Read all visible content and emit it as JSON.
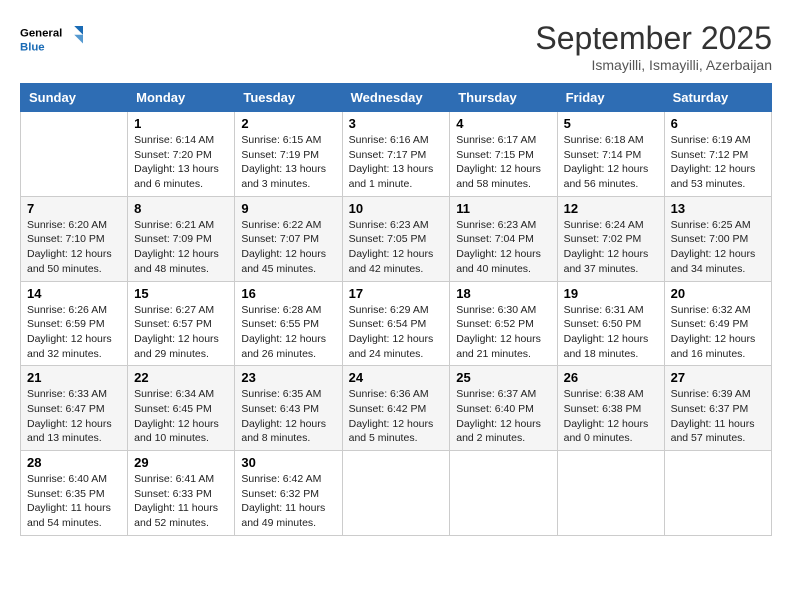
{
  "header": {
    "logo_line1": "General",
    "logo_line2": "Blue",
    "month": "September 2025",
    "location": "Ismayilli, Ismayilli, Azerbaijan"
  },
  "days_of_week": [
    "Sunday",
    "Monday",
    "Tuesday",
    "Wednesday",
    "Thursday",
    "Friday",
    "Saturday"
  ],
  "weeks": [
    [
      {
        "day": "",
        "info": ""
      },
      {
        "day": "1",
        "info": "Sunrise: 6:14 AM\nSunset: 7:20 PM\nDaylight: 13 hours\nand 6 minutes."
      },
      {
        "day": "2",
        "info": "Sunrise: 6:15 AM\nSunset: 7:19 PM\nDaylight: 13 hours\nand 3 minutes."
      },
      {
        "day": "3",
        "info": "Sunrise: 6:16 AM\nSunset: 7:17 PM\nDaylight: 13 hours\nand 1 minute."
      },
      {
        "day": "4",
        "info": "Sunrise: 6:17 AM\nSunset: 7:15 PM\nDaylight: 12 hours\nand 58 minutes."
      },
      {
        "day": "5",
        "info": "Sunrise: 6:18 AM\nSunset: 7:14 PM\nDaylight: 12 hours\nand 56 minutes."
      },
      {
        "day": "6",
        "info": "Sunrise: 6:19 AM\nSunset: 7:12 PM\nDaylight: 12 hours\nand 53 minutes."
      }
    ],
    [
      {
        "day": "7",
        "info": "Sunrise: 6:20 AM\nSunset: 7:10 PM\nDaylight: 12 hours\nand 50 minutes."
      },
      {
        "day": "8",
        "info": "Sunrise: 6:21 AM\nSunset: 7:09 PM\nDaylight: 12 hours\nand 48 minutes."
      },
      {
        "day": "9",
        "info": "Sunrise: 6:22 AM\nSunset: 7:07 PM\nDaylight: 12 hours\nand 45 minutes."
      },
      {
        "day": "10",
        "info": "Sunrise: 6:23 AM\nSunset: 7:05 PM\nDaylight: 12 hours\nand 42 minutes."
      },
      {
        "day": "11",
        "info": "Sunrise: 6:23 AM\nSunset: 7:04 PM\nDaylight: 12 hours\nand 40 minutes."
      },
      {
        "day": "12",
        "info": "Sunrise: 6:24 AM\nSunset: 7:02 PM\nDaylight: 12 hours\nand 37 minutes."
      },
      {
        "day": "13",
        "info": "Sunrise: 6:25 AM\nSunset: 7:00 PM\nDaylight: 12 hours\nand 34 minutes."
      }
    ],
    [
      {
        "day": "14",
        "info": "Sunrise: 6:26 AM\nSunset: 6:59 PM\nDaylight: 12 hours\nand 32 minutes."
      },
      {
        "day": "15",
        "info": "Sunrise: 6:27 AM\nSunset: 6:57 PM\nDaylight: 12 hours\nand 29 minutes."
      },
      {
        "day": "16",
        "info": "Sunrise: 6:28 AM\nSunset: 6:55 PM\nDaylight: 12 hours\nand 26 minutes."
      },
      {
        "day": "17",
        "info": "Sunrise: 6:29 AM\nSunset: 6:54 PM\nDaylight: 12 hours\nand 24 minutes."
      },
      {
        "day": "18",
        "info": "Sunrise: 6:30 AM\nSunset: 6:52 PM\nDaylight: 12 hours\nand 21 minutes."
      },
      {
        "day": "19",
        "info": "Sunrise: 6:31 AM\nSunset: 6:50 PM\nDaylight: 12 hours\nand 18 minutes."
      },
      {
        "day": "20",
        "info": "Sunrise: 6:32 AM\nSunset: 6:49 PM\nDaylight: 12 hours\nand 16 minutes."
      }
    ],
    [
      {
        "day": "21",
        "info": "Sunrise: 6:33 AM\nSunset: 6:47 PM\nDaylight: 12 hours\nand 13 minutes."
      },
      {
        "day": "22",
        "info": "Sunrise: 6:34 AM\nSunset: 6:45 PM\nDaylight: 12 hours\nand 10 minutes."
      },
      {
        "day": "23",
        "info": "Sunrise: 6:35 AM\nSunset: 6:43 PM\nDaylight: 12 hours\nand 8 minutes."
      },
      {
        "day": "24",
        "info": "Sunrise: 6:36 AM\nSunset: 6:42 PM\nDaylight: 12 hours\nand 5 minutes."
      },
      {
        "day": "25",
        "info": "Sunrise: 6:37 AM\nSunset: 6:40 PM\nDaylight: 12 hours\nand 2 minutes."
      },
      {
        "day": "26",
        "info": "Sunrise: 6:38 AM\nSunset: 6:38 PM\nDaylight: 12 hours\nand 0 minutes."
      },
      {
        "day": "27",
        "info": "Sunrise: 6:39 AM\nSunset: 6:37 PM\nDaylight: 11 hours\nand 57 minutes."
      }
    ],
    [
      {
        "day": "28",
        "info": "Sunrise: 6:40 AM\nSunset: 6:35 PM\nDaylight: 11 hours\nand 54 minutes."
      },
      {
        "day": "29",
        "info": "Sunrise: 6:41 AM\nSunset: 6:33 PM\nDaylight: 11 hours\nand 52 minutes."
      },
      {
        "day": "30",
        "info": "Sunrise: 6:42 AM\nSunset: 6:32 PM\nDaylight: 11 hours\nand 49 minutes."
      },
      {
        "day": "",
        "info": ""
      },
      {
        "day": "",
        "info": ""
      },
      {
        "day": "",
        "info": ""
      },
      {
        "day": "",
        "info": ""
      }
    ]
  ]
}
